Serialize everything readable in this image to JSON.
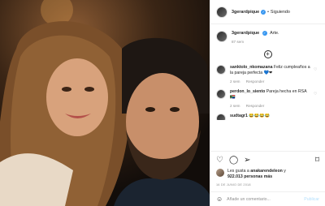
{
  "post": {
    "username": "3gerardpique",
    "follow_label": "Siguiendo",
    "caption_text": "Arte.",
    "caption_time": "87 sem",
    "comments": [
      {
        "user": "sanktolo_nkomazana",
        "text": "Feliz cumpleaños a la pareja perfecta 💙❤",
        "time": "2 sem",
        "reply": "Responder"
      },
      {
        "user": "perdon_lo_siento",
        "text": "Pareja hecha en RSA 🇿🇦",
        "time": "2 sem",
        "reply": "Responder"
      },
      {
        "user": "sudtagr1",
        "text": "😂😂😂😂",
        "time": "",
        "reply": ""
      }
    ],
    "likes_text_1": "Les gusta a",
    "likes_user": "anakarendeleon",
    "likes_text_2": "y",
    "likes_count": "922.013",
    "likes_text_3": "personas más",
    "date": "16 DE JUNIO DE 2018",
    "add_comment_placeholder": "Añade un comentario...",
    "publish_label": "Publicar"
  },
  "colors": {
    "accent": "#3897f0",
    "publish_disabled": "#b2dffc",
    "muted": "#8e8e8e"
  },
  "icons": {
    "like": "heart-icon",
    "comment": "comment-icon",
    "share": "paper-plane-icon",
    "save": "bookmark-icon",
    "more": "plus-circle-icon",
    "emoji": "smile-icon"
  }
}
